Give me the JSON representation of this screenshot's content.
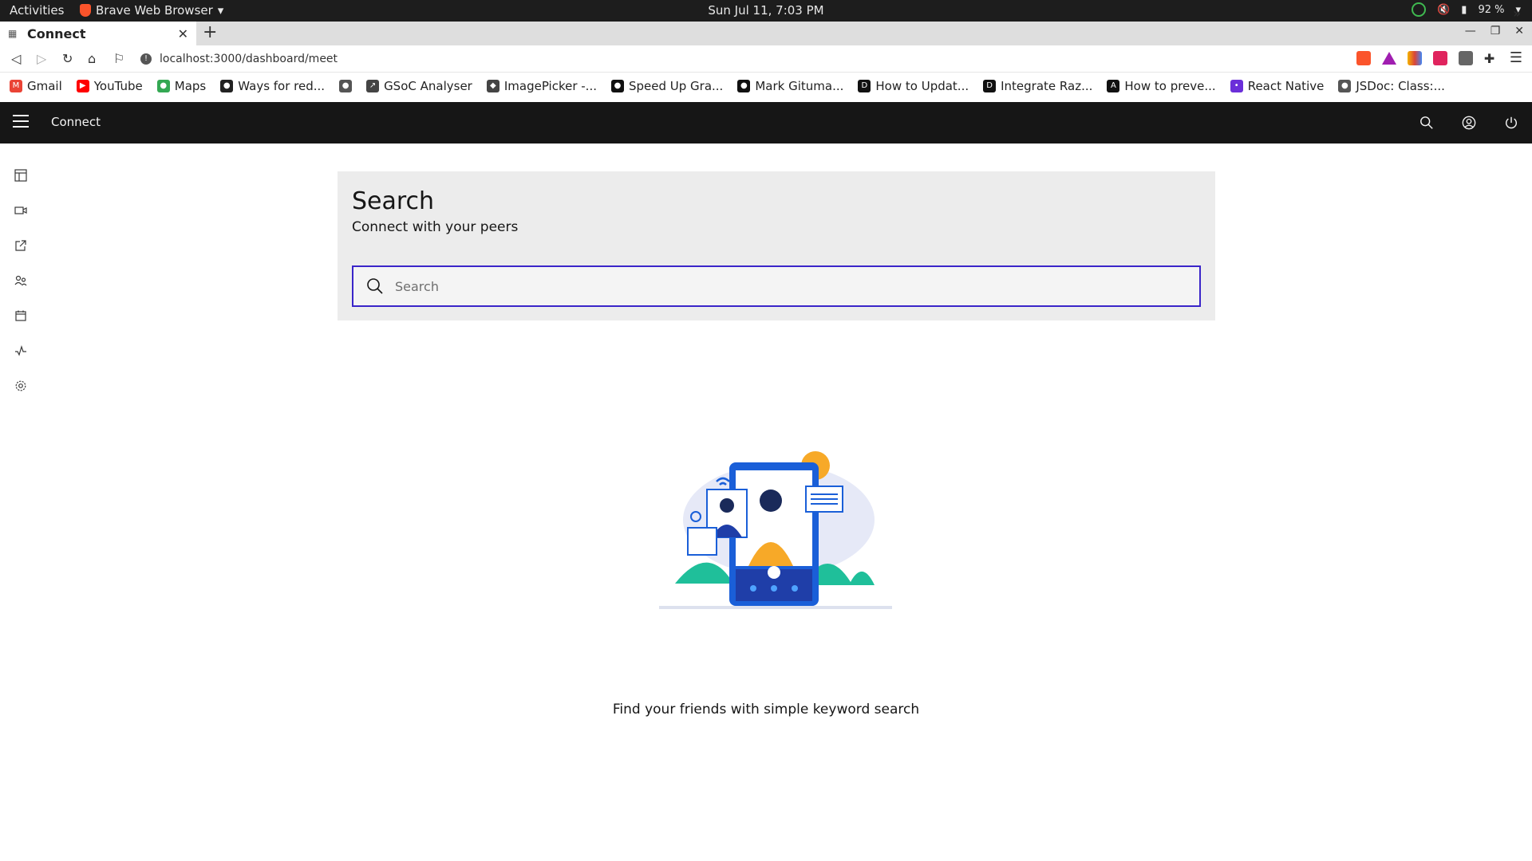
{
  "system": {
    "activities": "Activities",
    "app_menu": "Brave Web Browser",
    "clock": "Sun Jul 11,  7:03 PM",
    "battery": "92 %"
  },
  "browser": {
    "tab_title": "Connect",
    "url": "localhost:3000/dashboard/meet",
    "bookmarks": [
      {
        "label": "Gmail",
        "color": "#ea4335",
        "glyph": "M"
      },
      {
        "label": "YouTube",
        "color": "#ff0000",
        "glyph": "▶"
      },
      {
        "label": "Maps",
        "color": "#34a853",
        "glyph": "●"
      },
      {
        "label": "Ways for red...",
        "color": "#222222",
        "glyph": "●"
      },
      {
        "label": "",
        "color": "#555555",
        "glyph": "●"
      },
      {
        "label": "GSoC Analyser",
        "color": "#444444",
        "glyph": "↗"
      },
      {
        "label": "ImagePicker -...",
        "color": "#444444",
        "glyph": "◆"
      },
      {
        "label": "Speed Up Gra...",
        "color": "#111111",
        "glyph": "●"
      },
      {
        "label": "Mark Gituma...",
        "color": "#111111",
        "glyph": "●"
      },
      {
        "label": "How to Updat...",
        "color": "#111111",
        "glyph": "D"
      },
      {
        "label": "Integrate Raz...",
        "color": "#111111",
        "glyph": "D"
      },
      {
        "label": "How to preve...",
        "color": "#111111",
        "glyph": "A"
      },
      {
        "label": "React Native",
        "color": "#6b2fd9",
        "glyph": "•"
      },
      {
        "label": "JSDoc: Class:...",
        "color": "#555555",
        "glyph": "●"
      }
    ]
  },
  "app": {
    "name": "Connect",
    "panel": {
      "title": "Search",
      "subtitle": "Connect with your peers",
      "search_placeholder": "Search"
    },
    "tagline": "Find your friends with simple keyword search"
  },
  "colors": {
    "header_bg": "#161616",
    "panel_bg": "#ececec",
    "focus_border": "#3a25c9"
  }
}
